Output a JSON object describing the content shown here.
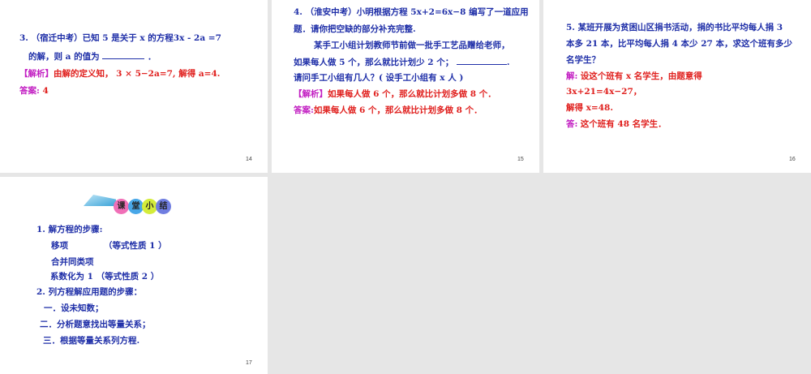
{
  "slides": [
    {
      "number": "14",
      "q": "3. （宿迁中考）已知 5 是关于 x 的方程3x - 2a =7",
      "q2": "的解，则 a 的值为",
      "q2end": "．",
      "analysis_tag": "【解析】",
      "analysis": "由解的定义知， 3 × 5−2a=7, 解得 a=4.",
      "answer_tag": "答案:",
      "answer": " 4"
    },
    {
      "number": "15",
      "lines": [
        "4. （淮安中考）小明根据方程 5x+2=6x−8 编写了一道应用",
        "题．请你把空缺的部分补充完整.",
        "某手工小组计划教师节前做一批手工艺品赠给老师，",
        "如果每人做 5 个，那么就比计划少 2 个；",
        "请问手工小组有几人？( 设手工小组有 x 人 )"
      ],
      "blank_end": ".",
      "analysis_tag": "【解析】",
      "analysis": "如果每人做 6 个，那么就比计划多做 8 个．",
      "answer_tag": "答案:",
      "answer": "如果每人做 6 个，那么就比计划多做 8 个．"
    },
    {
      "number": "16",
      "lines": [
        "5. 某班开展为贫困山区捐书活动，捐的书比平均每人捐 3",
        "本多 21 本，比平均每人捐 4 本少 27 本，求这个班有多少",
        "名学生？"
      ],
      "sol_tag": "解:",
      "sol": "设这个班有 x 名学生，由题意得",
      "eq": "3x+21=4x−27，",
      "res": "解得  x=48.",
      "ans_tag": "答:",
      "ans": "这个班有 48 名学生．"
    },
    {
      "number": "17",
      "banner": [
        "课",
        "堂",
        "小",
        "结"
      ],
      "lines": [
        "1.  解方程的步骤:",
        "移项",
        "（等式性质 1 ）",
        "合并同类项",
        "系数化为 1  （等式性质 2 ）",
        "2.   列方程解应用题的步骤：",
        "一．设未知数；",
        "二．分析题意找出等量关系；",
        "三．根据等量关系列方程."
      ]
    }
  ],
  "colors": {
    "text": "#1f2fa8",
    "analysis": "#e0201e",
    "tag": "#c21ec2",
    "background": "#e6e6e6"
  }
}
